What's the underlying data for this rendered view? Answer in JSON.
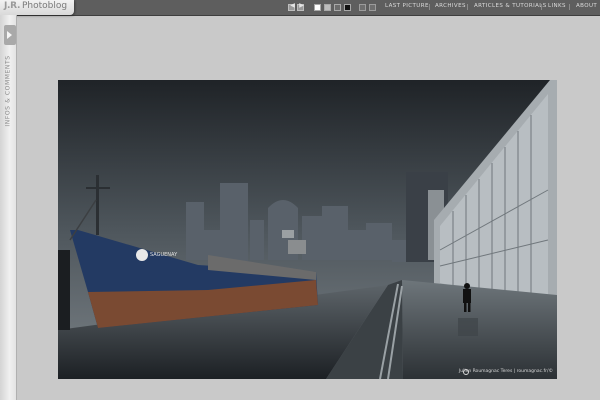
{
  "brand": {
    "mark": "J.R.",
    "name": "Photoblog"
  },
  "topbar": {
    "prev_arrow": "◀",
    "next_arrow": "▶",
    "swatches": [
      {
        "name": "white",
        "color": "#ffffff"
      },
      {
        "name": "light-gray",
        "color": "#bdbdbd"
      },
      {
        "name": "dark-gray",
        "color": "#6b6b6b"
      },
      {
        "name": "black",
        "color": "#111111"
      }
    ],
    "nav": {
      "last_picture": "LAST PICTURE",
      "archives": "ARCHIVES",
      "articles": "ARTICLES & TUTORIALS",
      "links": "LINKS",
      "about": "ABOUT"
    }
  },
  "sidebar": {
    "label": "INFOS & COMMENTS"
  },
  "photo": {
    "ship_name": "SAGUENAY",
    "watermark": "Julien Roumagnac Teres | roumagnac.fr/©"
  },
  "colors": {
    "topbar_bg": "#5e5e5e",
    "page_bg": "#c9c9c9",
    "sidebar_bg": "#e6e6e6",
    "hull_blue": "#233a63",
    "hull_rust": "#7a4a32"
  }
}
